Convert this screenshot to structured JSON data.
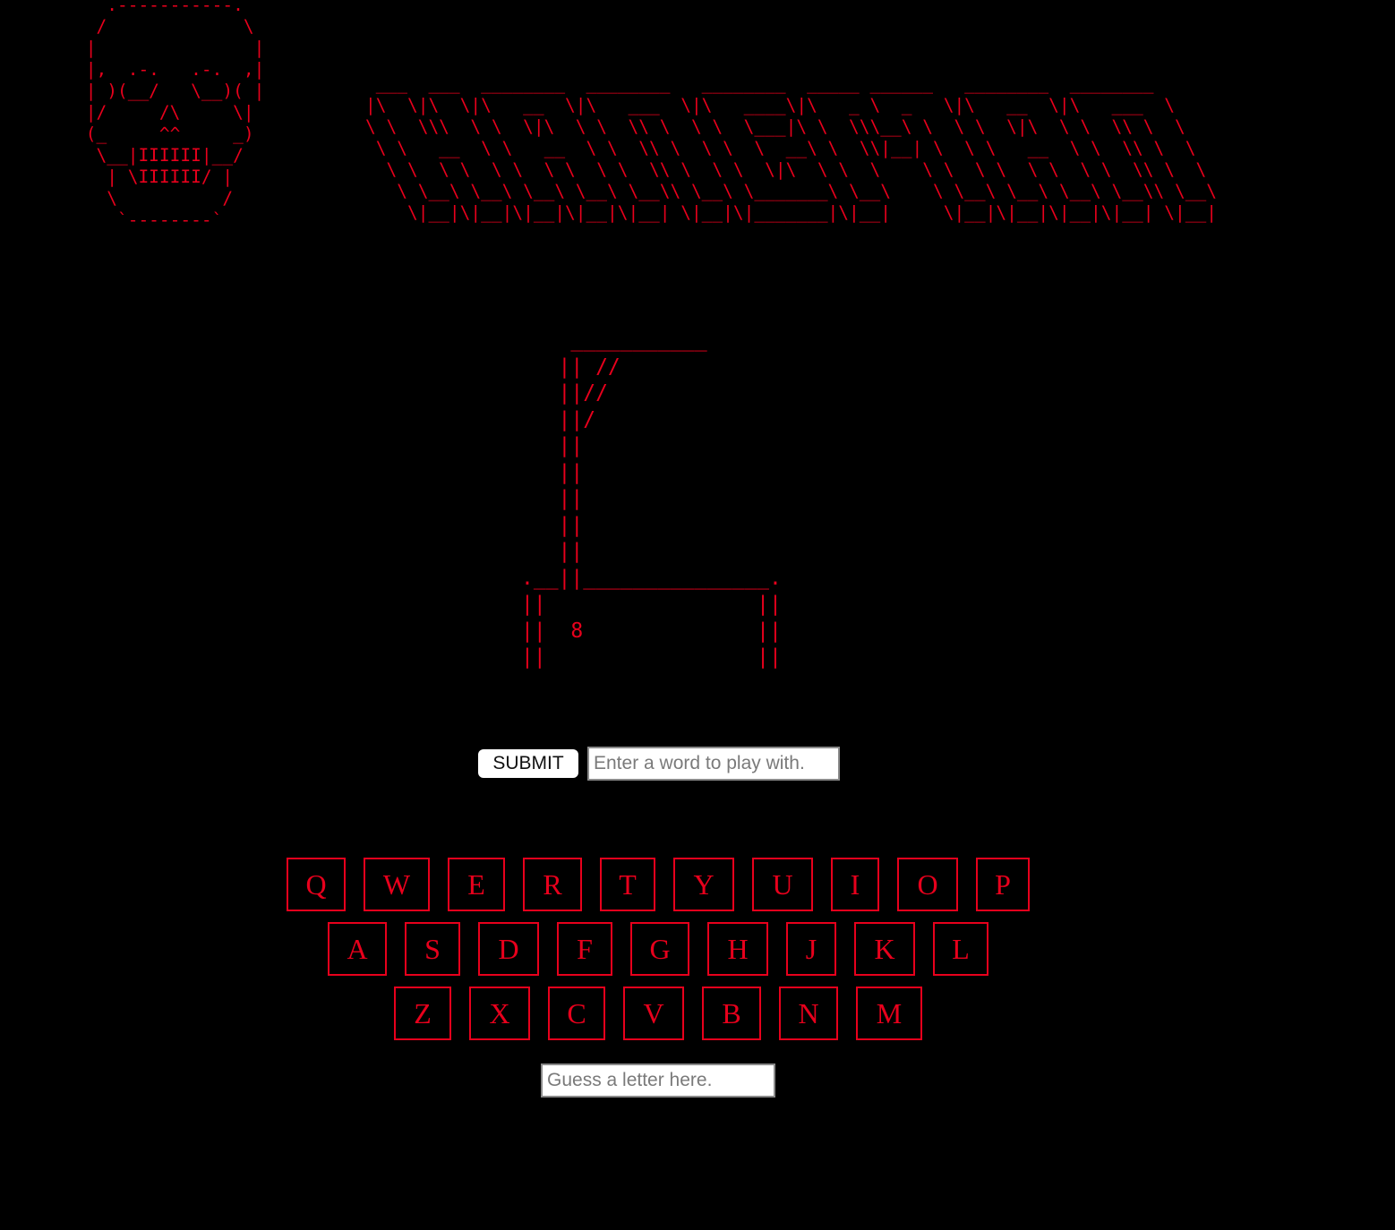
{
  "skull_art": "   .-----------.\n  /             \\\n |               |\n |,  .-.   .-.  ,|\n | )(__/   \\__)( |\n |/     /\\     \\|\n (_     ^^     _)\n  \\__|IIIIII|__/\n   | \\IIIIII/ |\n   \\          /\n    `--------`",
  "title_art": " ___  ___  ________  ________   ________  _____ ______   ________  ________      \n|\\  \\|\\  \\|\\   __  \\|\\   ___  \\|\\   ____\\|\\   _ \\  _   \\|\\   __  \\|\\   ___  \\    \n\\ \\  \\\\\\  \\ \\  \\|\\  \\ \\  \\\\ \\  \\ \\  \\___|\\ \\  \\\\\\__\\ \\  \\ \\  \\|\\  \\ \\  \\\\ \\  \\   \n \\ \\   __  \\ \\   __  \\ \\  \\\\ \\  \\ \\  \\  __\\ \\  \\\\|__| \\  \\ \\   __  \\ \\  \\\\ \\  \\  \n  \\ \\  \\ \\  \\ \\  \\ \\  \\ \\  \\\\ \\  \\ \\  \\|\\  \\ \\  \\    \\ \\  \\ \\  \\ \\  \\ \\  \\\\ \\  \\ \n   \\ \\__\\ \\__\\ \\__\\ \\__\\ \\__\\\\ \\__\\ \\_______\\ \\__\\    \\ \\__\\ \\__\\ \\__\\ \\__\\\\ \\__\\\n    \\|__|\\|__|\\|__|\\|__|\\|__| \\|__|\\|_______|\\|__|     \\|__|\\|__|\\|__|\\|__| \\|__|",
  "gallows_art": "    ___________\n   || //\n   ||//\n   ||/\n   ||\n   ||\n   ||\n   ||\n   ||\n.__||_______________.\n||                 ||\n||  8              ||\n||                 ||",
  "word_form": {
    "submit_label": "SUBMIT",
    "word_placeholder": "Enter a word to play with."
  },
  "keyboard": {
    "rows": [
      [
        "Q",
        "W",
        "E",
        "R",
        "T",
        "Y",
        "U",
        "I",
        "O",
        "P"
      ],
      [
        "A",
        "S",
        "D",
        "F",
        "G",
        "H",
        "J",
        "K",
        "L"
      ],
      [
        "Z",
        "X",
        "C",
        "V",
        "B",
        "N",
        "M"
      ]
    ]
  },
  "guess_form": {
    "placeholder": "Guess a letter here."
  },
  "colors": {
    "background": "#000000",
    "accent": "#e8001c"
  }
}
